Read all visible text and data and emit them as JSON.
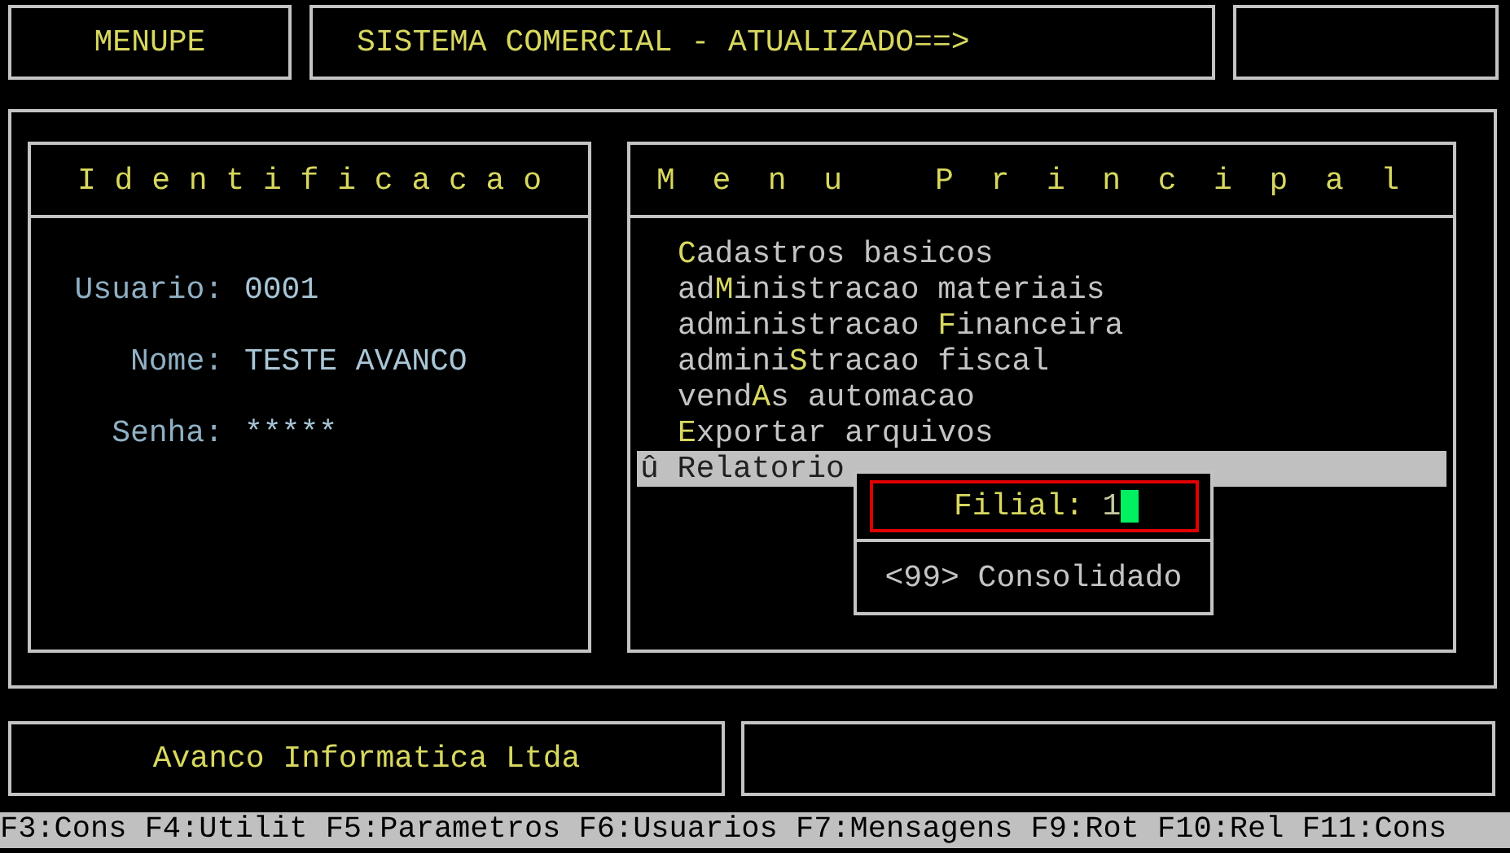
{
  "top_bar": {
    "program": "MENUPE",
    "system_title": "SISTEMA COMERCIAL - ATUALIZADO==>"
  },
  "identification": {
    "title": "I d e n t i f i c a c a o",
    "fields": [
      {
        "label": "Usuario:",
        "value": "0001"
      },
      {
        "label": "Nome:",
        "value": "TESTE AVANCO"
      },
      {
        "label": "Senha:",
        "value": "*****"
      }
    ]
  },
  "main_menu": {
    "title": "M  e  n  u     P  r  i  n  c  i  p  a  l",
    "items": [
      {
        "selected": false,
        "segments": [
          {
            "text": "C",
            "hotkey": true
          },
          {
            "text": "adastros basicos",
            "hotkey": false
          }
        ]
      },
      {
        "selected": false,
        "segments": [
          {
            "text": "ad",
            "hotkey": false
          },
          {
            "text": "M",
            "hotkey": true
          },
          {
            "text": "inistracao materiais",
            "hotkey": false
          }
        ]
      },
      {
        "selected": false,
        "segments": [
          {
            "text": "administracao ",
            "hotkey": false
          },
          {
            "text": "F",
            "hotkey": true
          },
          {
            "text": "inanceira",
            "hotkey": false
          }
        ]
      },
      {
        "selected": false,
        "segments": [
          {
            "text": "admini",
            "hotkey": false
          },
          {
            "text": "S",
            "hotkey": true
          },
          {
            "text": "tracao fiscal",
            "hotkey": false
          }
        ]
      },
      {
        "selected": false,
        "segments": [
          {
            "text": "vend",
            "hotkey": false
          },
          {
            "text": "A",
            "hotkey": true
          },
          {
            "text": "s automacao",
            "hotkey": false
          }
        ]
      },
      {
        "selected": false,
        "segments": [
          {
            "text": "E",
            "hotkey": true
          },
          {
            "text": "xportar arquivos",
            "hotkey": false
          }
        ]
      },
      {
        "selected": true,
        "segments": [
          {
            "text": "û Relatorio",
            "hotkey": false
          }
        ]
      }
    ]
  },
  "branch_dialog": {
    "label": "Filial:",
    "value": "1",
    "hint": "<99> Consolidado"
  },
  "footer": {
    "company": "Avanco Informatica Ltda"
  },
  "function_keys": "F3:Cons F4:Utilit F5:Parametros F6:Usuarios F7:Mensagens F9:Rot F10:Rel F11:Cons"
}
